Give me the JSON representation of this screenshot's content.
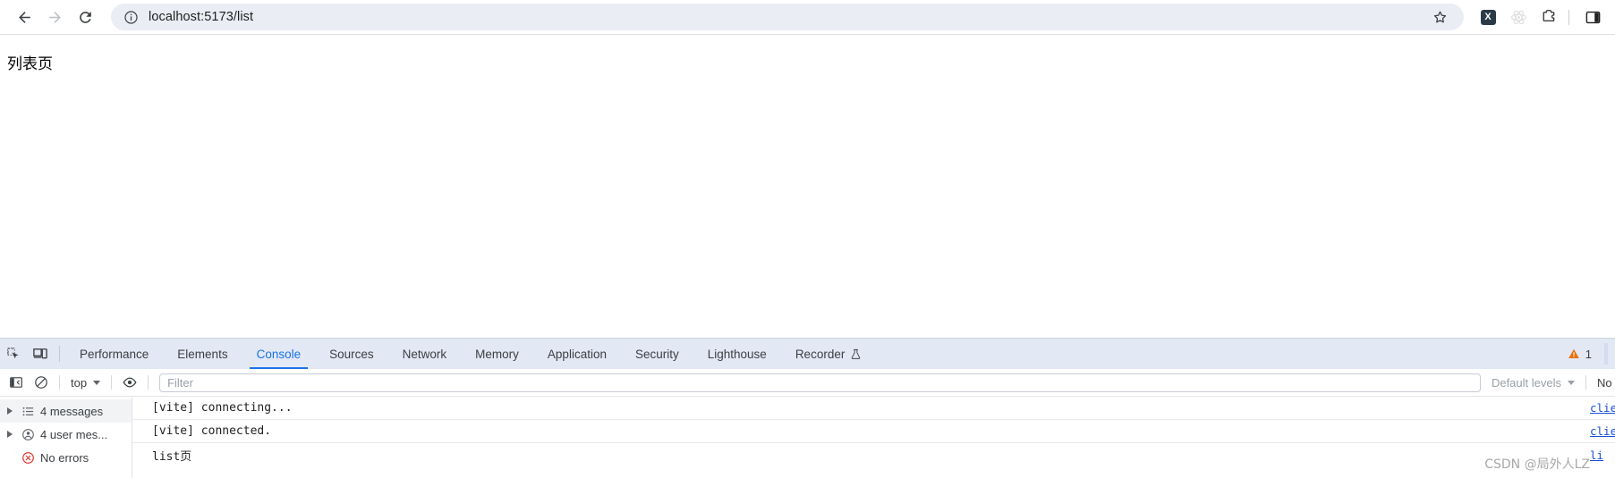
{
  "browser": {
    "back_label": "Back",
    "forward_label": "Forward",
    "reload_label": "Reload",
    "url": "localhost:5173/list",
    "site_info_label": "View site information",
    "bookmark_label": "Bookmark this tab",
    "extensions": [
      {
        "name": "x-extension-icon",
        "glyph": "X"
      },
      {
        "name": "react-devtools-icon",
        "glyph": ""
      },
      {
        "name": "extensions-puzzle-icon",
        "glyph": ""
      }
    ],
    "side_panel_label": "Side panel"
  },
  "page": {
    "heading": "列表页"
  },
  "devtools": {
    "left_icons": [
      {
        "name": "inspect-element-icon"
      },
      {
        "name": "device-toolbar-icon"
      }
    ],
    "tabs": [
      {
        "label": "Performance",
        "active": false
      },
      {
        "label": "Elements",
        "active": false
      },
      {
        "label": "Console",
        "active": true
      },
      {
        "label": "Sources",
        "active": false
      },
      {
        "label": "Network",
        "active": false
      },
      {
        "label": "Memory",
        "active": false
      },
      {
        "label": "Application",
        "active": false
      },
      {
        "label": "Security",
        "active": false
      },
      {
        "label": "Lighthouse",
        "active": false
      },
      {
        "label": "Recorder",
        "active": false,
        "experimental": true
      }
    ],
    "warning_count": "1",
    "console_toolbar": {
      "sidebar_toggle_label": "Show console sidebar",
      "clear_label": "Clear console",
      "context_value": "top",
      "eye_label": "Live expressions",
      "filter_placeholder": "Filter",
      "filter_value": "",
      "levels_value": "Default levels",
      "issues_label": "No"
    },
    "console_sidebar": [
      {
        "label": "4 messages",
        "icon": "list-icon",
        "expandable": true,
        "selected": true
      },
      {
        "label": "4 user mes...",
        "icon": "user-icon",
        "expandable": true,
        "selected": false
      },
      {
        "label": "No errors",
        "icon": "error-circle-icon",
        "expandable": false,
        "selected": false
      }
    ],
    "console_messages": [
      {
        "text": "[vite] connecting...",
        "source": "clie"
      },
      {
        "text": "[vite] connected.",
        "source": "clie"
      },
      {
        "text": "list页",
        "source": "li"
      }
    ]
  },
  "watermark": "CSDN @局外人LZ"
}
